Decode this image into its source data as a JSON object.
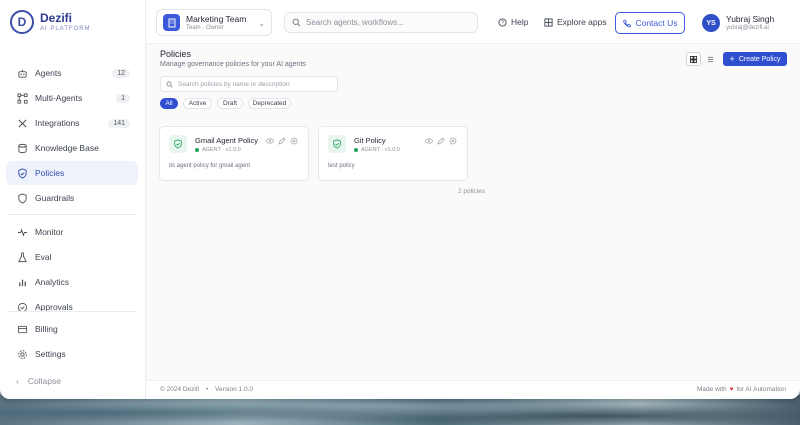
{
  "brand": {
    "name": "Dezifi",
    "subtitle": "AI PLATFORM",
    "logo_letter": "D"
  },
  "sidebar": {
    "items": [
      {
        "label": "Agents",
        "badge": "12",
        "icon": "robot-icon"
      },
      {
        "label": "Multi-Agents",
        "badge": "1",
        "icon": "network-icon"
      },
      {
        "label": "Integrations",
        "badge": "141",
        "icon": "tools-icon"
      },
      {
        "label": "Knowledge Base",
        "icon": "database-icon"
      },
      {
        "label": "Policies",
        "icon": "shield-check-icon",
        "active": true
      },
      {
        "label": "Guardrails",
        "icon": "shield-icon"
      },
      {
        "label": "Monitor",
        "icon": "pulse-icon"
      },
      {
        "label": "Eval",
        "icon": "flask-icon"
      },
      {
        "label": "Analytics",
        "icon": "bar-chart-icon"
      },
      {
        "label": "Approvals",
        "icon": "check-circle-icon"
      },
      {
        "label": "Billing",
        "icon": "card-icon"
      },
      {
        "label": "Settings",
        "icon": "gear-icon"
      }
    ],
    "collapse_label": "Collapse"
  },
  "header": {
    "team": {
      "name": "Marketing Team",
      "role": "Team · Owner"
    },
    "search_placeholder": "Search agents, workflows...",
    "help_label": "Help",
    "explore_label": "Explore apps",
    "contact_label": "Contact Us",
    "user": {
      "initials": "YS",
      "name": "Yubraj Singh",
      "email": "yubraj@dezifi.ai"
    }
  },
  "main": {
    "title": "Policies",
    "subtitle": "Manage governance policies for your AI agents",
    "create_label": "Create Policy",
    "search_placeholder": "Search policies by name or description",
    "filters": [
      "All",
      "Active",
      "Draft",
      "Deprecated"
    ],
    "active_filter": "All",
    "policies": [
      {
        "name": "Gmail Agent Policy",
        "meta": "AGENT · v1.0.0",
        "description": "its agent policy for gmail agent"
      },
      {
        "name": "Git Policy",
        "meta": "AGENT · v1.0.0",
        "description": "test policy"
      }
    ],
    "count_label": "2 policies"
  },
  "footer": {
    "copyright": "© 2024 Dezifi",
    "bullet": "•",
    "version": "Version 1.0.0",
    "made_with": "Made with",
    "for_text": "for AI Automation"
  },
  "colors": {
    "accent": "#2f4fd0",
    "active_nav_bg": "#eef2fb",
    "status_green": "#22a35a"
  }
}
